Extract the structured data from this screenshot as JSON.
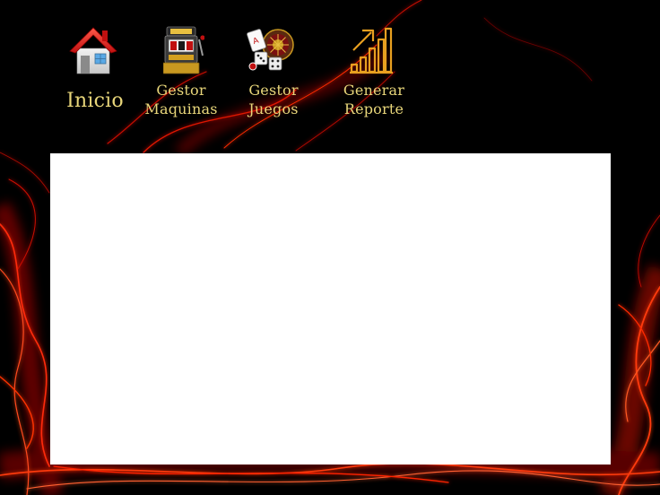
{
  "nav": {
    "items": [
      {
        "label": "Inicio",
        "icon": "home-icon"
      },
      {
        "label": "Gestor\nMaquinas",
        "icon": "slot-machine-icon"
      },
      {
        "label": "Gestor\nJuegos",
        "icon": "casino-games-icon"
      },
      {
        "label": "Generar\nReporte",
        "icon": "report-chart-icon"
      }
    ]
  },
  "colors": {
    "background": "#000000",
    "accent_red": "#ff2200",
    "label_gold": "#e8d67a",
    "panel": "#ffffff"
  }
}
